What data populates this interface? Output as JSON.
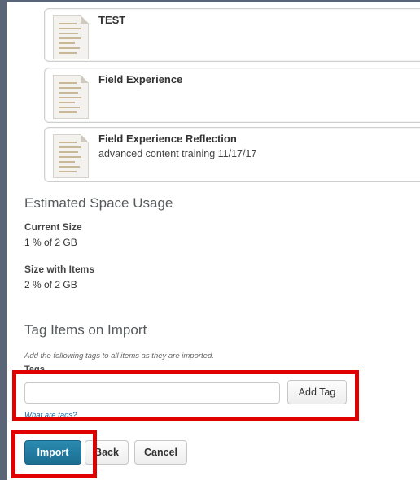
{
  "items": [
    {
      "title": "TEST",
      "subtitle": ""
    },
    {
      "title": "Field Experience",
      "subtitle": ""
    },
    {
      "title": "Field Experience Reflection",
      "subtitle": "advanced content training 11/17/17"
    }
  ],
  "space": {
    "heading": "Estimated Space Usage",
    "current_label": "Current Size",
    "current_value": "1 % of 2 GB",
    "with_items_label": "Size with Items",
    "with_items_value": "2 % of 2 GB"
  },
  "tags": {
    "heading": "Tag Items on Import",
    "help": "Add the following tags to all items as they are imported.",
    "label": "Tags",
    "input_value": "",
    "input_placeholder": "",
    "add_button": "Add Tag",
    "help_link": "What are tags?"
  },
  "actions": {
    "import": "Import",
    "back": "Back",
    "cancel": "Cancel"
  },
  "colors": {
    "primary_button": "#1c6f92",
    "highlight": "#e00000",
    "frame": "#5a6577"
  }
}
